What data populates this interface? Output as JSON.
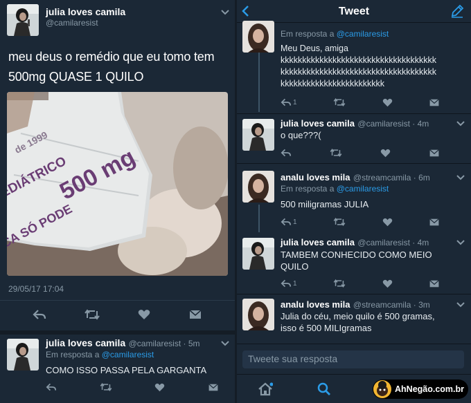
{
  "left": {
    "main_tweet": {
      "name": "julia loves camila",
      "handle": "@camilaresist",
      "text_line1": "meu deus o remédio que eu tomo tem",
      "text_line2": "500mg QUASE 1 QUILO",
      "timestamp": "29/05/17 17:04"
    },
    "reply_tweet": {
      "name": "julia loves camila",
      "handle": "@camilaresist · 5m",
      "reply_prefix": "Em resposta a",
      "reply_mention": "@camilaresist",
      "text": "COMO ISSO PASSA PELA GARGANTA"
    }
  },
  "right": {
    "title": "Tweet",
    "tweets": [
      {
        "reply_prefix": "Em resposta a",
        "reply_mention": "@camilaresist",
        "line1": "Meu Deus, amiga",
        "line2": "kkkkkkkkkkkkkkkkkkkkkkkkkkkkkkkkkkkk",
        "line3": "kkkkkkkkkkkkkkkkkkkkkkkkkkkkkkkkkkkk",
        "line4": "kkkkkkkkkkkkkkkkkkkkkkkk",
        "reply_count": "1"
      },
      {
        "name": "julia loves camila",
        "handle": "@camilaresist · 4m",
        "line1": "o que???("
      },
      {
        "name": "analu loves mila",
        "handle": "@streamcamila · 6m",
        "reply_prefix": "Em resposta a",
        "reply_mention": "@camilaresist",
        "line1": "500 miligramas JULIA",
        "reply_count": "1"
      },
      {
        "name": "julia loves camila",
        "handle": "@camilaresist · 4m",
        "line1": "TAMBEM CONHECIDO COMO MEIO",
        "line2": "QUILO",
        "reply_count": "1"
      },
      {
        "name": "analu loves mila",
        "handle": "@streamcamila · 3m",
        "line1": "Julia do céu, meio quilo é 500 gramas,",
        "line2": "isso é 500 MILIgramas"
      }
    ],
    "reply_placeholder": "Tweete sua resposta"
  },
  "photo": {
    "blister_lines": [
      "de 1999",
      "500 mg",
      "PEDIÁTRICO",
      "CA SÓ PODE"
    ]
  },
  "watermark": "AhNegão.com.br",
  "colors": {
    "background": "#1b2836",
    "accent": "#2b9ce8",
    "muted": "#8899a6"
  }
}
